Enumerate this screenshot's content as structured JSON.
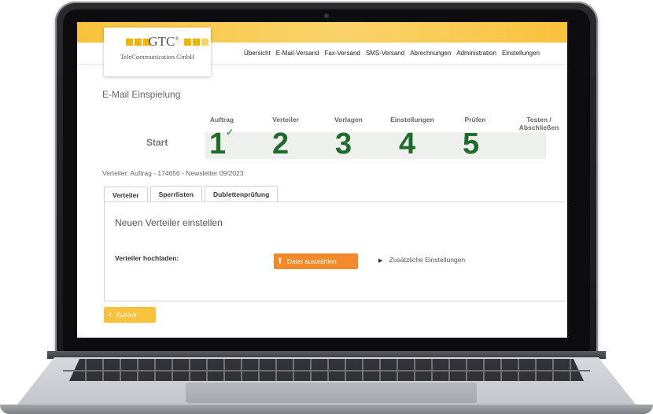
{
  "logo": {
    "name": "GTC",
    "registered": "®",
    "subtitle": "TeleCommunication GmbH"
  },
  "nav": {
    "items": [
      "Übersicht",
      "E-Mail-Versand",
      "Fax-Versand",
      "SMS-Versand",
      "Abrechnungen",
      "Administration",
      "Einstellungen"
    ]
  },
  "page": {
    "title": "E-Mail Einspielung"
  },
  "stepper": {
    "start_label": "Start",
    "steps": [
      {
        "label": "Auftrag",
        "number": "1",
        "done": true
      },
      {
        "label": "Verteiler",
        "number": "2"
      },
      {
        "label": "Vorlagen",
        "number": "3"
      },
      {
        "label": "Einstellungen",
        "number": "4"
      },
      {
        "label": "Prüfen",
        "number": "5"
      },
      {
        "label": "Testen / Abschließen",
        "number": ""
      }
    ],
    "check_icon": "check-icon",
    "accent_color": "#1f6b2a"
  },
  "info": {
    "verteiler_line": "Verteiler: Auftrag -  174656  - Newsletter 09/2023"
  },
  "tabs": [
    {
      "label": "Verteiler",
      "active": true
    },
    {
      "label": "Sperrlisten",
      "active": false
    },
    {
      "label": "Dublettenprüfung",
      "active": false
    }
  ],
  "panel": {
    "heading": "Neuen Verteiler einstellen",
    "upload_label": "Verteiler hochladen:",
    "upload_button": "Datei auswählen",
    "upload_icon": "upload-icon",
    "extra_settings": "Zusätzliche Einstellungen"
  },
  "footer": {
    "back_button": "Zurück",
    "back_icon": "chevron-left-icon"
  },
  "colors": {
    "brand_yellow": "#f9c23c",
    "upload_orange": "#f28a2a",
    "step_green": "#1f6b2a"
  }
}
